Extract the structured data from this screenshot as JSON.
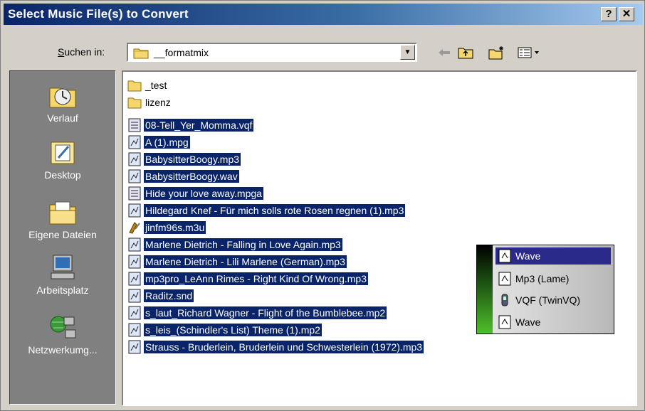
{
  "window": {
    "title": "Select Music File(s) to Convert",
    "help_label": "?",
    "close_label": "✕"
  },
  "lookin": {
    "label_underlined": "S",
    "label_rest": "uchen in:",
    "folder_value": "__formatmix"
  },
  "places": [
    {
      "label": "Verlauf",
      "icon": "history-icon"
    },
    {
      "label": "Desktop",
      "icon": "desktop-icon"
    },
    {
      "label": "Eigene Dateien",
      "icon": "my-documents-icon"
    },
    {
      "label": "Arbeitsplatz",
      "icon": "my-computer-icon"
    },
    {
      "label": "Netzwerkumg...",
      "icon": "network-icon"
    }
  ],
  "files": [
    {
      "name": "_test",
      "type": "folder",
      "selected": false
    },
    {
      "name": "lizenz",
      "type": "folder",
      "selected": false
    },
    {
      "name": "08-Tell_Yer_Momma.vqf",
      "type": "vqf",
      "selected": true
    },
    {
      "name": "A (1).mpg",
      "type": "audio",
      "selected": true
    },
    {
      "name": "BabysitterBoogy.mp3",
      "type": "audio",
      "selected": true
    },
    {
      "name": "BabysitterBoogy.wav",
      "type": "audio",
      "selected": true
    },
    {
      "name": "Hide your love away.mpga",
      "type": "vqf",
      "selected": true
    },
    {
      "name": "Hildegard Knef - Für mich solls rote Rosen regnen (1).mp3",
      "type": "audio",
      "selected": true
    },
    {
      "name": "jinfm96s.m3u",
      "type": "playlist",
      "selected": true
    },
    {
      "name": "Marlene Dietrich - Falling in Love Again.mp3",
      "type": "audio",
      "selected": true
    },
    {
      "name": "Marlene Dietrich - Lili Marlene (German).mp3",
      "type": "audio",
      "selected": true
    },
    {
      "name": "mp3pro_LeAnn Rimes - Right Kind Of Wrong.mp3",
      "type": "audio",
      "selected": true
    },
    {
      "name": "Raditz.snd",
      "type": "audio",
      "selected": true
    },
    {
      "name": "s_laut_Richard Wagner - Flight of the Bumblebee.mp2",
      "type": "audio",
      "selected": true
    },
    {
      "name": "s_leis_(Schindler's List) Theme (1).mp2",
      "type": "audio",
      "selected": true
    },
    {
      "name": "Strauss - Bruderlein, Bruderlein und Schwesterlein (1972).mp3",
      "type": "audio",
      "selected": true
    }
  ],
  "popup": [
    {
      "label": "Wave",
      "highlighted": true,
      "icon": "wave-icon"
    },
    {
      "label": "Mp3 (Lame)",
      "highlighted": false,
      "icon": "wave-icon"
    },
    {
      "label": "VQF (TwinVQ)",
      "highlighted": false,
      "icon": "vqf-icon"
    },
    {
      "label": "Wave",
      "highlighted": false,
      "icon": "wave-icon"
    }
  ],
  "colors": {
    "selection": "#0a246a",
    "titlebar_start": "#0a246a",
    "titlebar_end": "#a6caf0",
    "places_bg": "#808080",
    "popup_strip": "#4fbf2a"
  }
}
